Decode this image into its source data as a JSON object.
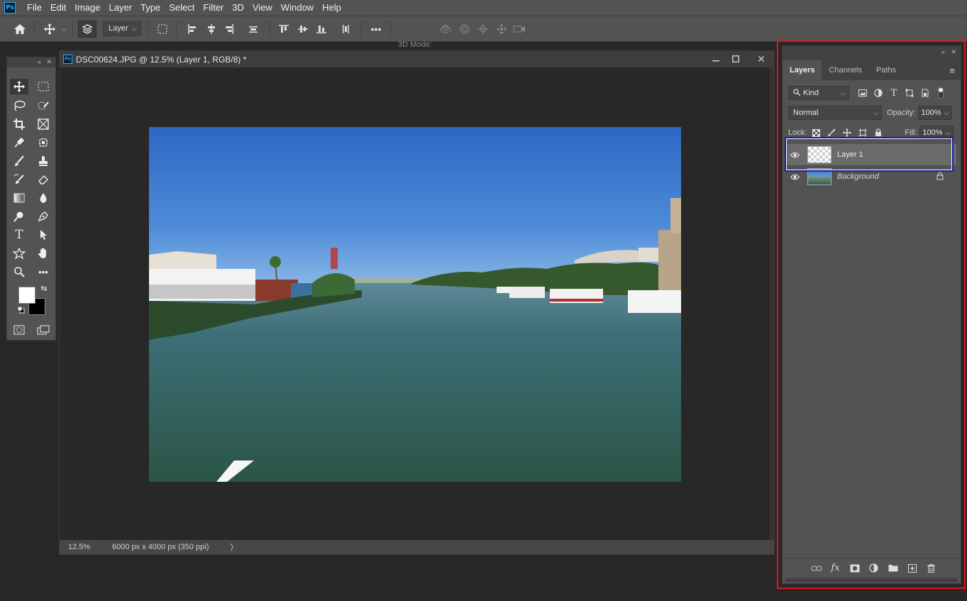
{
  "menubar": {
    "items": [
      "File",
      "Edit",
      "Image",
      "Layer",
      "Type",
      "Select",
      "Filter",
      "3D",
      "View",
      "Window",
      "Help"
    ],
    "app_icon": "Ps"
  },
  "options_bar": {
    "auto_select_target": "Layer",
    "mode_3d_label": "3D Mode:"
  },
  "document": {
    "title": "DSC00624.JPG @ 12.5% (Layer 1, RGB/8) *",
    "zoom": "12.5%",
    "dimensions": "6000 px x 4000 px (350 ppi)",
    "status_arrow": "〉"
  },
  "colors": {
    "foreground": "#ffffff",
    "background": "#000000",
    "highlight_outline": "#e8121a",
    "selection_outline": "#1420a0"
  },
  "layers_panel": {
    "tabs": [
      "Layers",
      "Channels",
      "Paths"
    ],
    "active_tab": "Layers",
    "filter_kind": "Kind",
    "blend_mode": "Normal",
    "opacity_label": "Opacity:",
    "opacity": "100%",
    "lock_label": "Lock:",
    "fill_label": "Fill:",
    "fill": "100%",
    "layers": [
      {
        "name": "Layer 1",
        "selected": true,
        "visible": true,
        "locked": false
      },
      {
        "name": "Background",
        "selected": false,
        "visible": true,
        "locked": true
      }
    ]
  }
}
